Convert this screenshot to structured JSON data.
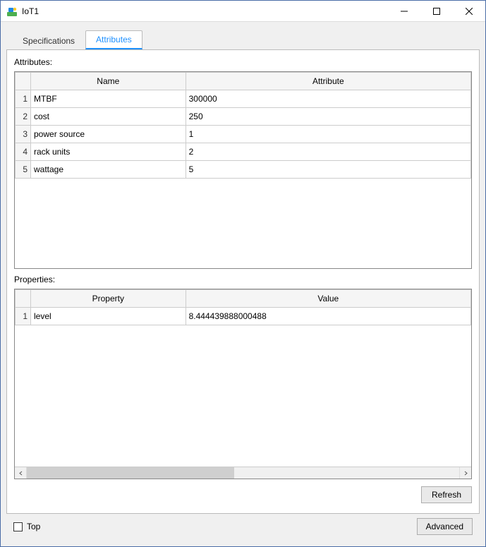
{
  "window": {
    "title": "IoT1"
  },
  "tabs": [
    {
      "label": "Specifications"
    },
    {
      "label": "Attributes"
    }
  ],
  "active_tab": 1,
  "attributes_section": {
    "label": "Attributes:",
    "columns": {
      "name": "Name",
      "attribute": "Attribute"
    },
    "rows": [
      {
        "num": "1",
        "name": "MTBF",
        "attribute": "300000"
      },
      {
        "num": "2",
        "name": "cost",
        "attribute": "250"
      },
      {
        "num": "3",
        "name": "power source",
        "attribute": "1"
      },
      {
        "num": "4",
        "name": "rack units",
        "attribute": "2"
      },
      {
        "num": "5",
        "name": "wattage",
        "attribute": "5"
      }
    ]
  },
  "properties_section": {
    "label": "Properties:",
    "columns": {
      "property": "Property",
      "value": "Value"
    },
    "rows": [
      {
        "num": "1",
        "property": "level",
        "value": "8.444439888000488"
      }
    ]
  },
  "buttons": {
    "refresh": "Refresh",
    "advanced": "Advanced"
  },
  "checkbox": {
    "top": "Top"
  }
}
